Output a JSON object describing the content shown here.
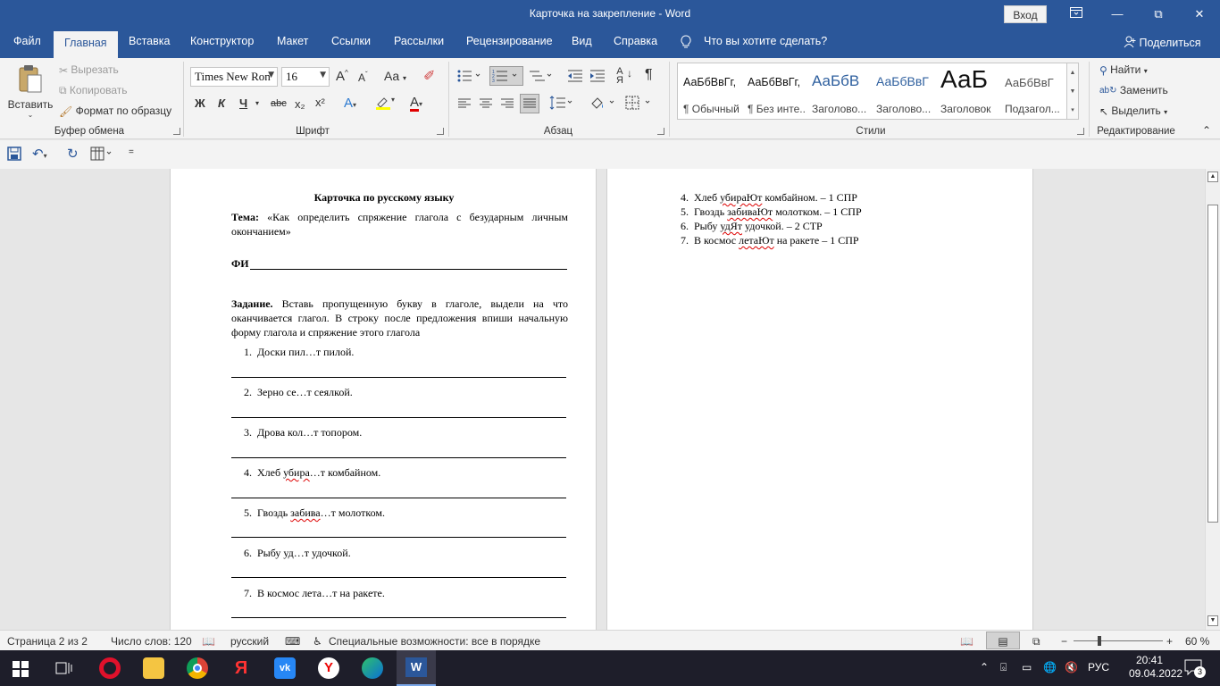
{
  "window": {
    "title": "Карточка на закрепление  -  Word",
    "signin": "Вход",
    "controls": [
      "—",
      "⧉",
      "✕"
    ]
  },
  "tabs": {
    "items": [
      "Файл",
      "Главная",
      "Вставка",
      "Конструктор",
      "Макет",
      "Ссылки",
      "Рассылки",
      "Рецензирование",
      "Вид",
      "Справка"
    ],
    "tell_me": "Что вы хотите сделать?",
    "share": "Поделиться"
  },
  "ribbon": {
    "clipboard": {
      "paste": "Вставить",
      "cut": "Вырезать",
      "copy": "Копировать",
      "format_painter": "Формат по образцу",
      "label": "Буфер обмена"
    },
    "font": {
      "font_name": "Times New Ron",
      "font_size": "16",
      "bold": "Ж",
      "italic": "К",
      "underline": "Ч",
      "strike": "abc",
      "subscript": "x₂",
      "superscript": "x²",
      "grow": "A",
      "shrink": "A",
      "case": "Aa",
      "label": "Шрифт"
    },
    "paragraph": {
      "label": "Абзац",
      "pilcrow": "¶"
    },
    "styles": {
      "items": [
        {
          "sample": "АаБбВвГг,",
          "name": "¶ Обычный"
        },
        {
          "sample": "АаБбВвГг,",
          "name": "¶ Без инте..."
        },
        {
          "sample": "АаБбВ",
          "name": "Заголово..."
        },
        {
          "sample": "АаБбВвГ",
          "name": "Заголово..."
        },
        {
          "sample": "АаБ",
          "name": "Заголовок"
        },
        {
          "sample": "АаБбВвГ",
          "name": "Подзагол..."
        }
      ],
      "label": "Стили"
    },
    "editing": {
      "find": "Найти",
      "replace": "Заменить",
      "select": "Выделить",
      "label": "Редактирование"
    }
  },
  "document": {
    "page1": {
      "heading": "Карточка по русскому языку",
      "topic_label": "Тема:",
      "topic_text": " «Как определить спряжение глагола с безударным личным окончанием»",
      "fi_label": "ФИ",
      "task_label": "Задание.",
      "task_text": " Вставь пропущенную букву в глаголе, выдели на что оканчивается глагол. В строку после предложения впиши начальную форму глагола и спряжение этого глагола",
      "items": [
        {
          "num": "1.",
          "pre": "Доски пил…т пилой.",
          "wavy": "",
          "post": ""
        },
        {
          "num": "2.",
          "pre": "Зерно се…т сеялкой.",
          "wavy": "",
          "post": ""
        },
        {
          "num": "3.",
          "pre": "Дрова кол…т топором.",
          "wavy": "",
          "post": ""
        },
        {
          "num": "4.",
          "pre": "Хлеб ",
          "wavy": "убира",
          "post": "…т комбайном."
        },
        {
          "num": "5.",
          "pre": "Гвоздь ",
          "wavy": "забива",
          "post": "…т молотком."
        },
        {
          "num": "6.",
          "pre": "Рыбу уд…т удочкой.",
          "wavy": "",
          "post": ""
        },
        {
          "num": "7.",
          "pre": "В космос лета…т на ракете.",
          "wavy": "",
          "post": ""
        }
      ]
    },
    "page2": {
      "items": [
        {
          "num": "4.",
          "pre": "Хлеб ",
          "wavy": "убираЮт",
          "post": " комбайном. – 1 СПР"
        },
        {
          "num": "5.",
          "pre": "Гвоздь ",
          "wavy": "забиваЮт",
          "post": " молотком. – 1 СПР"
        },
        {
          "num": "6.",
          "pre": "Рыбу ",
          "wavy": "удЯт",
          "post": " удочкой. – 2 СТР"
        },
        {
          "num": "7.",
          "pre": "В космос ",
          "wavy": "летаЮт",
          "post": " на ракете – 1 СПР"
        }
      ]
    }
  },
  "status": {
    "page": "Страница 2 из 2",
    "words": "Число слов: 120",
    "language": "русский",
    "accessibility": "Специальные возможности: все в порядке",
    "zoom": "60 %",
    "zoom_minus": "−",
    "zoom_plus": "+"
  },
  "taskbar": {
    "lang": "РУС",
    "time": "20:41",
    "date": "09.04.2022",
    "notifications": "3"
  }
}
